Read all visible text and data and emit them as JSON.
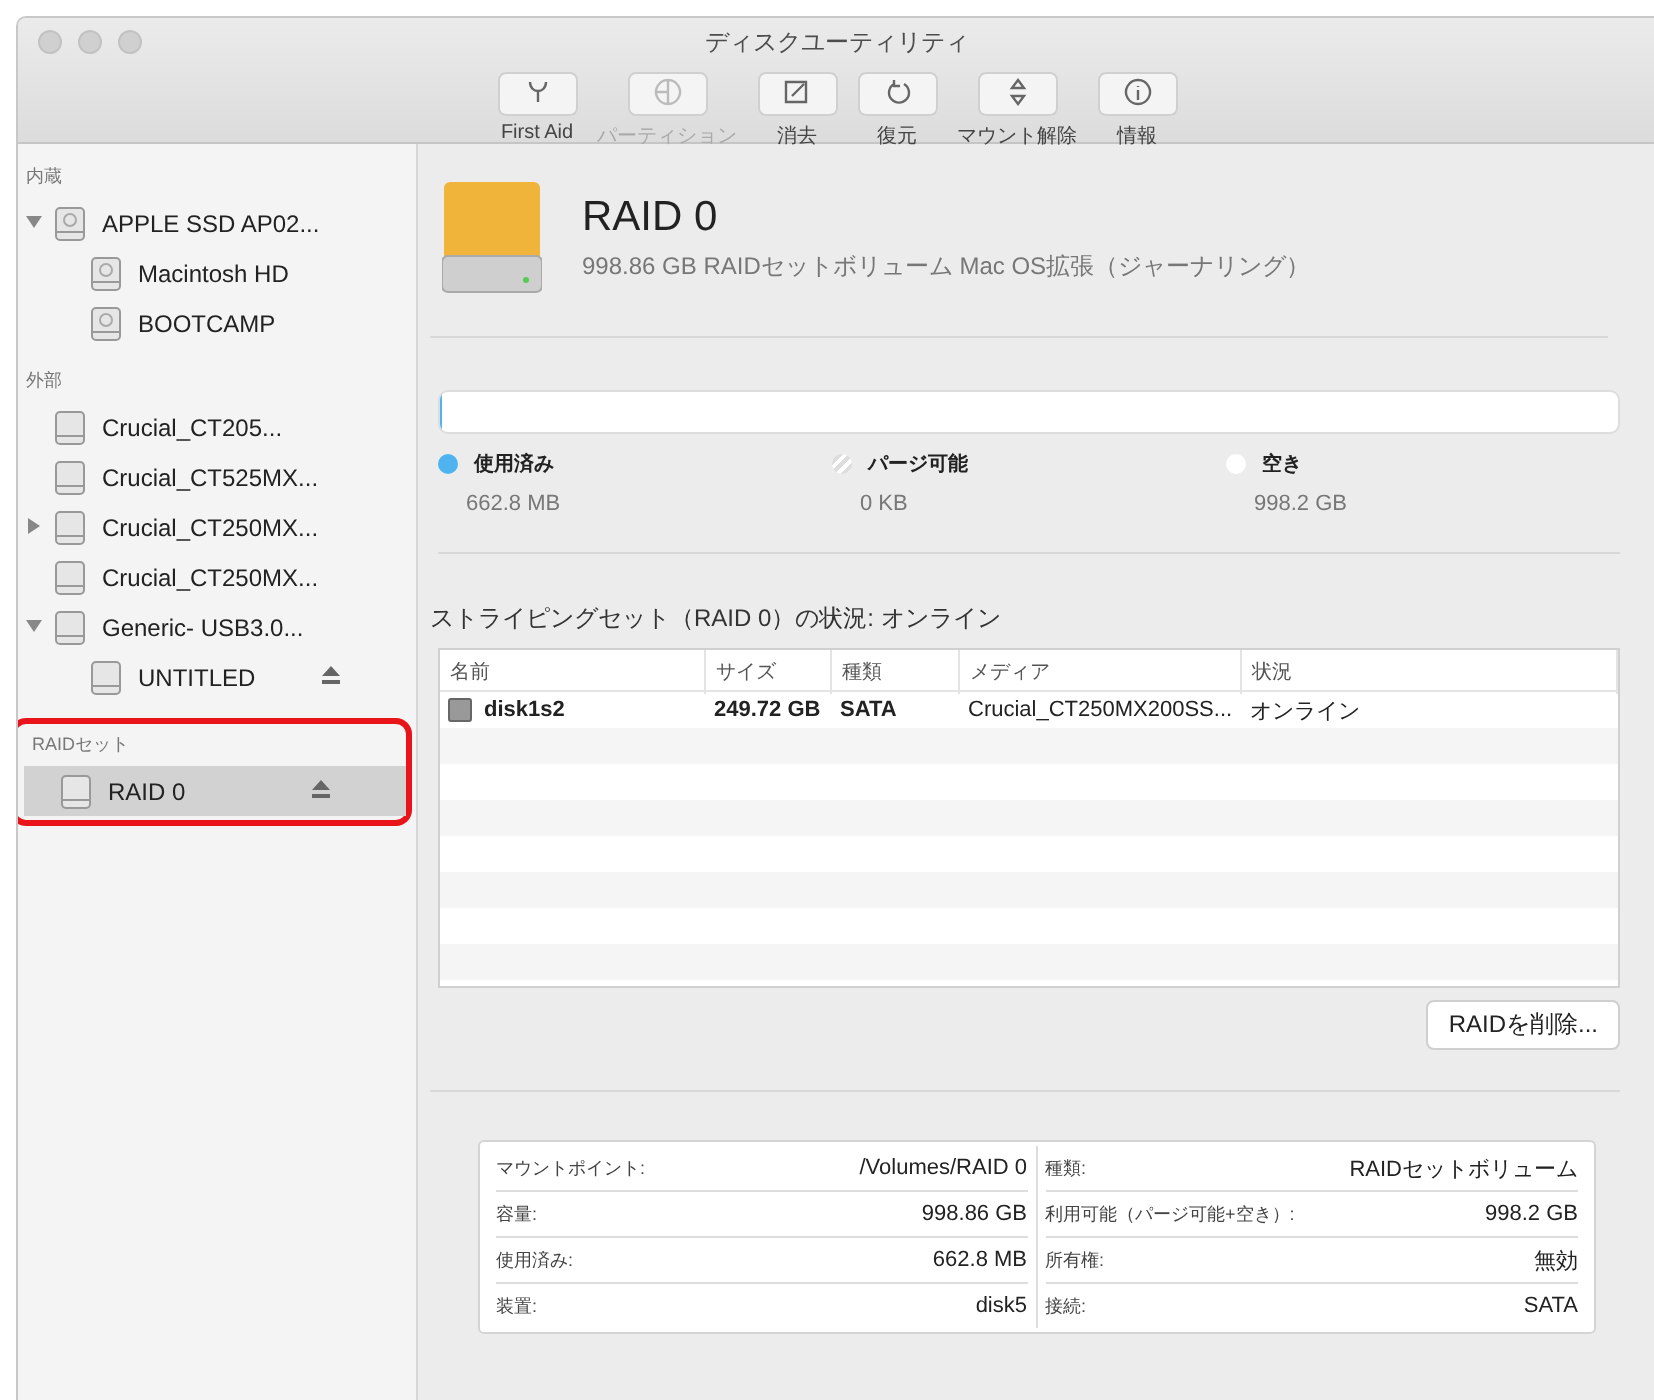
{
  "window": {
    "title": "ディスクユーティリティ"
  },
  "toolbar": [
    {
      "label": "First Aid",
      "disabled": false
    },
    {
      "label": "パーティション",
      "disabled": true
    },
    {
      "label": "消去",
      "disabled": false
    },
    {
      "label": "復元",
      "disabled": false
    },
    {
      "label": "マウント解除",
      "disabled": false
    },
    {
      "label": "情報",
      "disabled": false
    }
  ],
  "sidebar": {
    "sections": [
      {
        "title": "内蔵",
        "items": [
          {
            "name": "APPLE SSD AP02...",
            "kind": "internal",
            "selected": false,
            "expanded": true,
            "ejectable": false,
            "children": [
              {
                "name": "Macintosh HD",
                "kind": "internal",
                "selected": false,
                "ejectable": false
              },
              {
                "name": "BOOTCAMP",
                "kind": "internal",
                "selected": false,
                "ejectable": false
              }
            ]
          }
        ]
      },
      {
        "title": "外部",
        "items": [
          {
            "name": "Crucial_CT205...",
            "kind": "external",
            "selected": false,
            "ejectable": false
          },
          {
            "name": "Crucial_CT525MX...",
            "kind": "external",
            "selected": false,
            "ejectable": false
          },
          {
            "name": "Crucial_CT250MX...",
            "kind": "external",
            "selected": false,
            "expanded": false,
            "ejectable": false
          },
          {
            "name": "Crucial_CT250MX...",
            "kind": "external",
            "selected": false,
            "ejectable": false
          },
          {
            "name": "Generic- USB3.0...",
            "kind": "external",
            "selected": false,
            "expanded": true,
            "ejectable": false,
            "children": [
              {
                "name": "UNTITLED",
                "kind": "external",
                "selected": false,
                "ejectable": true
              }
            ]
          }
        ]
      },
      {
        "title": "RAIDセット",
        "highlighted": true,
        "items": [
          {
            "name": "RAID 0",
            "kind": "external",
            "selected": true,
            "ejectable": true
          }
        ]
      }
    ]
  },
  "volume": {
    "name": "RAID 0",
    "description": "998.86 GB RAIDセットボリューム Mac OS拡張（ジャーナリング）"
  },
  "usage": {
    "level": 0.0007,
    "legend": [
      {
        "label": "使用済み",
        "value": "662.8 MB",
        "color": "#4fb3f0",
        "kind": "solid"
      },
      {
        "label": "パージ可能",
        "value": "0 KB",
        "color": "#ffffff",
        "kind": "striped"
      },
      {
        "label": "空き",
        "value": "998.2 GB",
        "color": "#ffffff",
        "kind": "solid"
      }
    ]
  },
  "raid": {
    "status": "ストライピングセット（RAID 0）の状況: オンライン",
    "columns": [
      "名前",
      "サイズ",
      "種類",
      "メディア",
      "状況"
    ],
    "rows": [
      [
        "disk1s2",
        "249.72 GB",
        "SATA",
        "Crucial_CT250MX200SS...",
        "オンライン"
      ]
    ],
    "delete_button": "RAIDを削除..."
  },
  "info": [
    [
      {
        "label": "マウントポイント:",
        "value": "/Volumes/RAID 0"
      },
      {
        "label": "容量:",
        "value": "998.86 GB"
      },
      {
        "label": "使用済み:",
        "value": "662.8 MB"
      },
      {
        "label": "装置:",
        "value": "disk5"
      }
    ],
    [
      {
        "label": "種類:",
        "value": "RAIDセットボリューム"
      },
      {
        "label": "利用可能（パージ可能+空き）:",
        "value": "998.2 GB"
      },
      {
        "label": "所有権:",
        "value": "無効"
      },
      {
        "label": "接続:",
        "value": "SATA"
      }
    ]
  ]
}
